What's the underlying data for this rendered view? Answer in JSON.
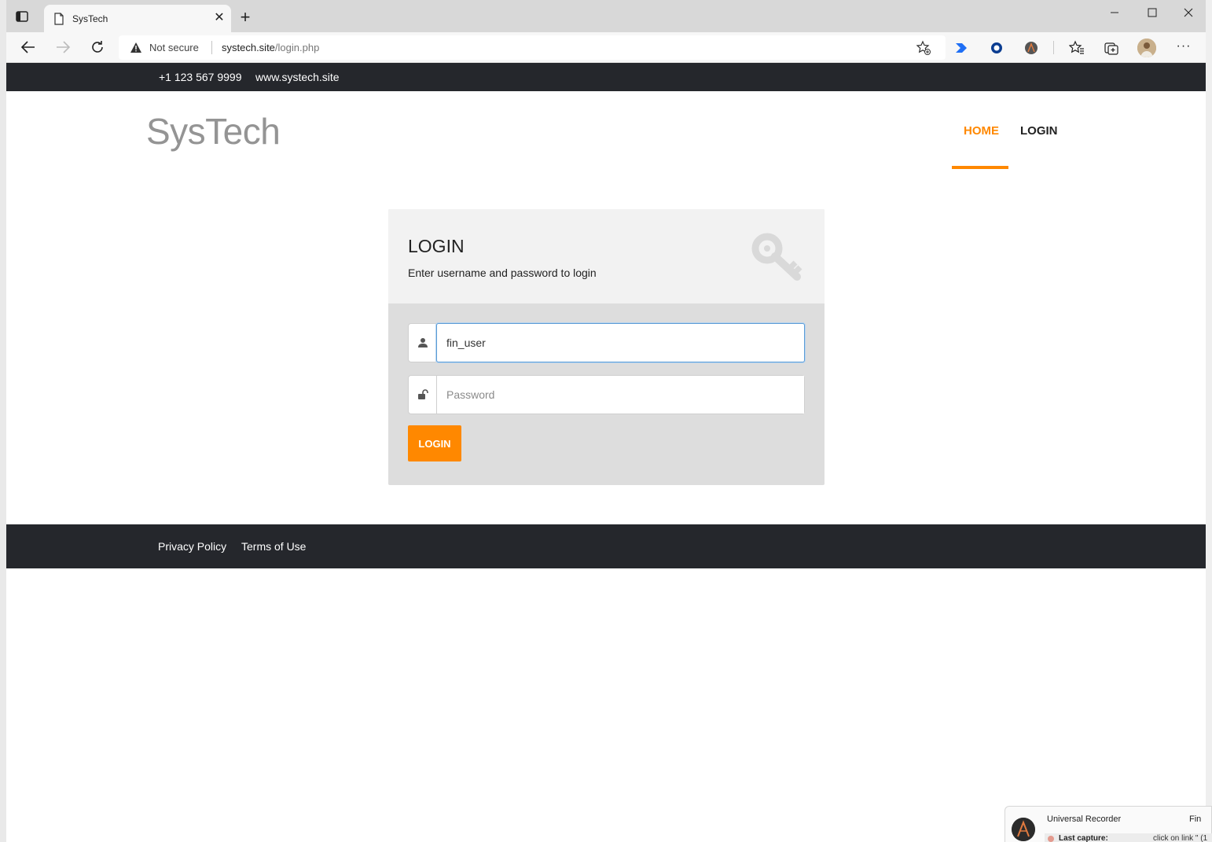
{
  "browser": {
    "tab": {
      "title": "SysTech"
    },
    "address_bar": {
      "security_label": "Not secure",
      "url_host": "systech.site",
      "url_path": "/login.php"
    }
  },
  "site": {
    "topbar": {
      "phone": "+1 123 567 9999",
      "website": "www.systech.site"
    },
    "logo": "SysTech",
    "nav": [
      {
        "label": "HOME",
        "active": true
      },
      {
        "label": "LOGIN",
        "active": false
      }
    ],
    "accent_color": "#ff8800",
    "dark_color": "#25272c"
  },
  "login_card": {
    "title": "LOGIN",
    "subtitle": "Enter username and password to login",
    "icon": "key-icon",
    "username": {
      "value": "fin_user",
      "icon": "user-icon"
    },
    "password": {
      "placeholder": "Password",
      "icon": "unlock-icon"
    },
    "submit_label": "LOGIN"
  },
  "footer": {
    "links": [
      "Privacy Policy",
      "Terms of Use"
    ]
  },
  "recorder": {
    "title": "Universal Recorder",
    "find_label": "Fin",
    "last_capture_label": "Last capture:",
    "last_capture_value": "click on link \" (1"
  }
}
